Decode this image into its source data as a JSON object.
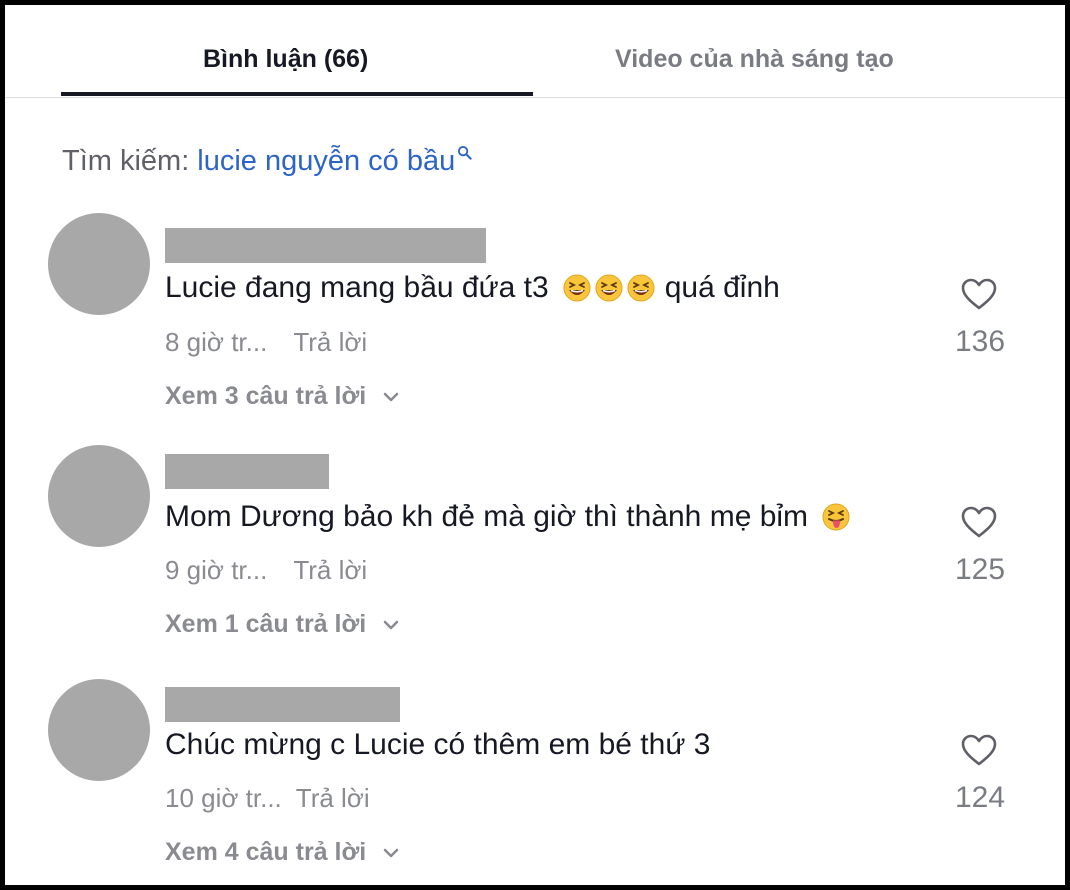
{
  "tabs": [
    {
      "label": "Bình luận (66)"
    },
    {
      "label": "Video của nhà sáng tạo"
    }
  ],
  "search": {
    "prefix": "Tìm kiếm:",
    "term": "lucie nguyễn có bầu"
  },
  "comments": [
    {
      "text": "Lucie đang mang bầu đứa t3",
      "text_after": "quá đỉnh",
      "emojis": [
        "grinning-squinting-face",
        "grinning-squinting-face",
        "grinning-squinting-face"
      ],
      "time": "8 giờ tr...",
      "reply": "Trả lời",
      "view_replies": "Xem 3 câu trả lời",
      "likes": "136"
    },
    {
      "text": "Mom Dương bảo kh đẻ mà giờ thì thành mẹ bỉm",
      "text_after": "",
      "emojis": [
        "squinting-face-with-tongue"
      ],
      "time": "9 giờ tr...",
      "reply": "Trả lời",
      "view_replies": "Xem 1 câu trả lời",
      "likes": "125"
    },
    {
      "text": "Chúc mừng c Lucie có thêm em bé thứ 3",
      "text_after": "",
      "emojis": [],
      "time": "10 giờ tr...",
      "reply": "Trả lời",
      "view_replies": "Xem 4 câu trả lời",
      "likes": "124"
    }
  ],
  "colors": {
    "search_term": "#2c64c8",
    "redacted_block": "#a8a8a8",
    "muted_text": "#8a8b91",
    "primary_text": "#161823"
  }
}
